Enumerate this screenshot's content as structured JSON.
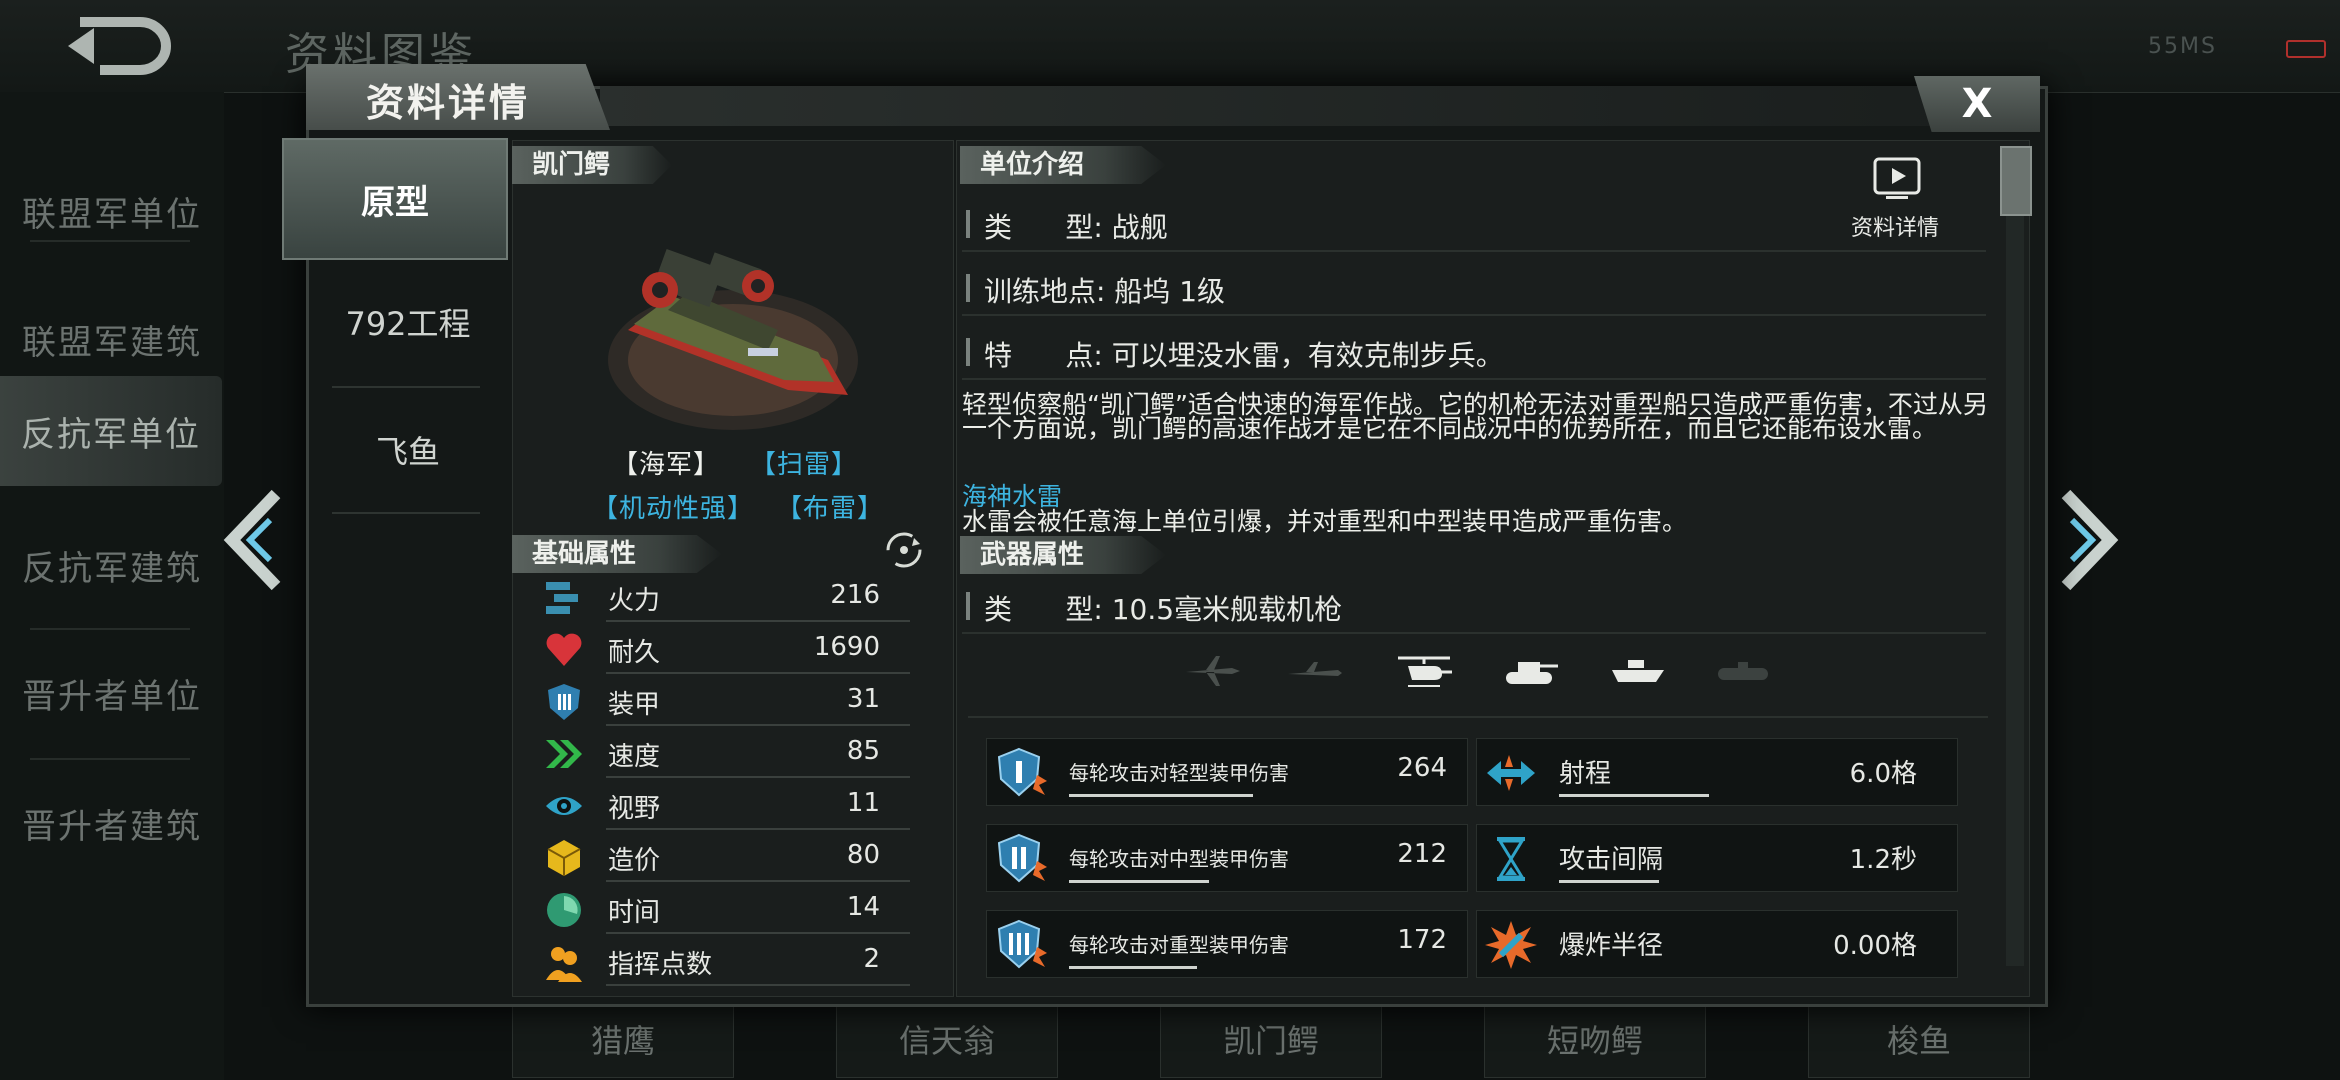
{
  "status_bar": {
    "carrier": "55MS"
  },
  "background": {
    "title": "资料图鉴",
    "nav_items": [
      {
        "label": "联盟军单位"
      },
      {
        "label": "联盟军建筑"
      },
      {
        "label": "反抗军单位"
      },
      {
        "label": "反抗军建筑"
      },
      {
        "label": "晋升者单位"
      },
      {
        "label": "晋升者建筑"
      }
    ],
    "bottom_tabs": [
      {
        "label": "猎鹰"
      },
      {
        "label": "信天翁"
      },
      {
        "label": "凯门鳄"
      },
      {
        "label": "短吻鳄"
      },
      {
        "label": "梭鱼"
      }
    ]
  },
  "modal": {
    "title": "资料详情",
    "close_label": "X",
    "variants": [
      {
        "label": "原型"
      },
      {
        "label": "792工程"
      },
      {
        "label": "飞鱼"
      }
    ]
  },
  "unit": {
    "name": "凯门鳄",
    "tags": [
      "【海军】",
      "【扫雷】",
      "【机动性强】",
      "【布雷】"
    ],
    "tag_colors": [
      "#eef0ec",
      "#3db4e0",
      "#3db4e0",
      "#3db4e0"
    ]
  },
  "base_stats": {
    "header": "基础属性",
    "rows": [
      {
        "label": "火力",
        "value": "216",
        "icon": "firepower-icon"
      },
      {
        "label": "耐久",
        "value": "1690",
        "icon": "heart-icon"
      },
      {
        "label": "装甲",
        "value": "31",
        "icon": "armor-icon"
      },
      {
        "label": "速度",
        "value": "85",
        "icon": "speed-icon"
      },
      {
        "label": "视野",
        "value": "11",
        "icon": "eye-icon"
      },
      {
        "label": "造价",
        "value": "80",
        "icon": "cost-icon"
      },
      {
        "label": "时间",
        "value": "14",
        "icon": "time-icon"
      },
      {
        "label": "指挥点数",
        "value": "2",
        "icon": "command-icon"
      }
    ]
  },
  "intro": {
    "header": "单位介绍",
    "detail_label": "资料详情",
    "type_line": "类      型: 战舰",
    "train_line": "训练地点: 船坞 1级",
    "feature_line": "特      点: 可以埋没水雷，有效克制步兵。",
    "description": "轻型侦察船“凯门鳄”适合快速的海军作战。它的机枪无法对重型船只造成严重伤害，不过从另一个方面说，凯门鳄的高速作战才是它在不同战况中的优势所在，而且它还能布设水雷。",
    "mine_title": "海神水雷",
    "mine_desc": "水雷会被任意海上单位引爆，并对重型和中型装甲造成严重伤害。"
  },
  "weapon": {
    "header": "武器属性",
    "type_line": "类      型: 10.5毫米舰载机枪",
    "targets": [
      "jet-icon",
      "plane-icon",
      "helicopter-icon",
      "tank-icon",
      "ship-icon",
      "submarine-icon"
    ],
    "damage": [
      {
        "label": "每轮攻击对轻型装甲伤害",
        "value": "264",
        "tier": "I"
      },
      {
        "label": "每轮攻击对中型装甲伤害",
        "value": "212",
        "tier": "II"
      },
      {
        "label": "每轮攻击对重型装甲伤害",
        "value": "172",
        "tier": "III"
      }
    ],
    "props": [
      {
        "label": "射程",
        "value": "6.0格"
      },
      {
        "label": "攻击间隔",
        "value": "1.2秒"
      },
      {
        "label": "爆炸半径",
        "value": "0.00格"
      }
    ]
  }
}
